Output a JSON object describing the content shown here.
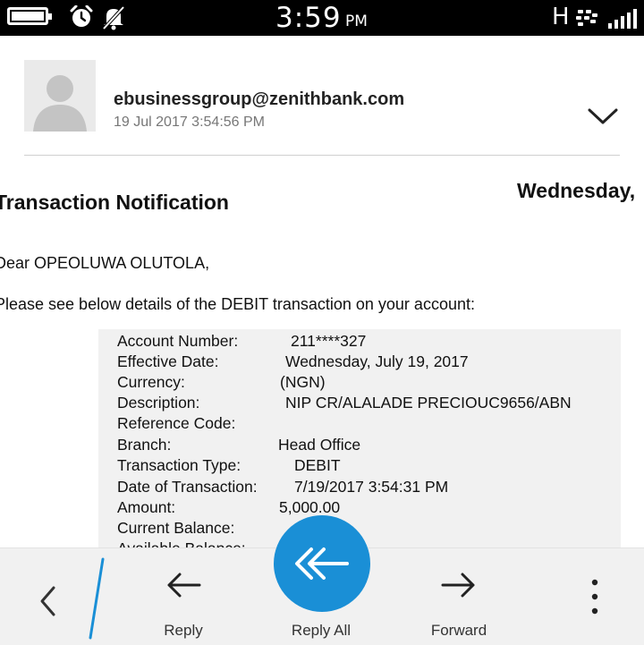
{
  "status_bar": {
    "time": "3:59",
    "ampm": "PM",
    "network": "H",
    "icons": [
      "battery-icon",
      "alarm-clock-icon",
      "notifications-muted-icon",
      "blackberry-icon",
      "signal-strength-icon"
    ]
  },
  "header": {
    "sender": "ebusinessgroup@zenithbank.com",
    "date": "19 Jul 2017 3:54:56 PM"
  },
  "email": {
    "title": "Transaction Notification",
    "weekday": "Wednesday,",
    "greeting": "Dear OPEOLUWA OLUTOLA,",
    "intro": "Please see below details of the DEBIT transaction on your account:",
    "details": [
      {
        "label": "Account Number:",
        "value": "211****327"
      },
      {
        "label": "Effective Date:",
        "value": "Wednesday, July 19, 2017"
      },
      {
        "label": "Currency:",
        "value": "(NGN)"
      },
      {
        "label": "Description:",
        "value": "NIP CR/ALALADE PRECIOUC9656/ABN"
      },
      {
        "label": "Reference Code:",
        "value": ""
      },
      {
        "label": "Branch:",
        "value": "Head Office"
      },
      {
        "label": "Transaction Type:",
        "value": "DEBIT"
      },
      {
        "label": "Date of Transaction:",
        "value": "7/19/2017 3:54:31 PM"
      },
      {
        "label": "Amount:",
        "value": "5,000.00"
      },
      {
        "label": "Current Balance:",
        "value": ""
      },
      {
        "label": "Available Balance:",
        "value": ""
      }
    ]
  },
  "action_bar": {
    "reply": "Reply",
    "reply_all": "Reply All",
    "forward": "Forward"
  },
  "colors": {
    "accent": "#1a8fd6",
    "status_bar_bg": "#000000",
    "action_bar_bg": "#f1f1f1",
    "details_bg": "#f1f1f1"
  }
}
